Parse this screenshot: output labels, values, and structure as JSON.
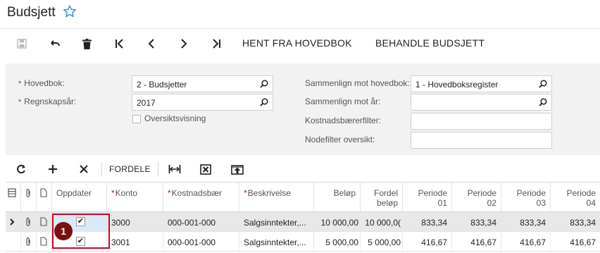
{
  "page": {
    "title": "Budsjett"
  },
  "toolbar": {
    "fetch_label": "HENT FRA HOVEDBOK",
    "process_label": "BEHANDLE BUDSJETT"
  },
  "form": {
    "ledger_label": "Hovedbok:",
    "ledger_value": "2 - Budsjetter",
    "fiscal_year_label": "Regnskapsår:",
    "fiscal_year_value": "2017",
    "tree_view_label": "Oversiktsvisning",
    "compare_ledger_label": "Sammenlign mot hovedbok:",
    "compare_ledger_value": "1 - Hovedboksregister",
    "compare_year_label": "Sammenlign mot år:",
    "compare_year_value": "",
    "cost_filter_label": "Kostnadsbærerfilter:",
    "cost_filter_value": "",
    "node_filter_label": "Nodefilter oversikt:",
    "node_filter_value": ""
  },
  "grid_toolbar": {
    "distribute_label": "FORDELE"
  },
  "grid": {
    "columns": {
      "update": "Oppdater",
      "account": "Konto",
      "cost": "Kostnadsbær",
      "description": "Beskrivelse",
      "amount": "Beløp",
      "distributed_line1": "Fordel",
      "distributed_line2": "beløp",
      "p1_line1": "Periode",
      "p1_line2": "01",
      "p2_line1": "Periode",
      "p2_line2": "02",
      "p3_line1": "Periode",
      "p3_line2": "03",
      "p4_line1": "Periode",
      "p4_line2": "04"
    },
    "rows": [
      {
        "checked": "✔",
        "account": "3000",
        "cost": "000-001-000",
        "description": "Salgsinntekter,...",
        "amount": "10 000,00",
        "distributed": "10 000,0(",
        "p1": "833,34",
        "p2": "833,34",
        "p3": "833,34",
        "p4": "833,34"
      },
      {
        "checked": "✔",
        "account": "3001",
        "cost": "000-001-000",
        "description": "Salgsinntekter,...",
        "amount": "5 000,00",
        "distributed": "5 000,00",
        "p1": "416,67",
        "p2": "416,67",
        "p3": "416,67",
        "p4": "416,67"
      }
    ]
  },
  "annotation": {
    "badge": "1",
    "color": "#d0021b"
  },
  "colors": {
    "star": "#3b8fd8",
    "required": "#d0021b"
  }
}
